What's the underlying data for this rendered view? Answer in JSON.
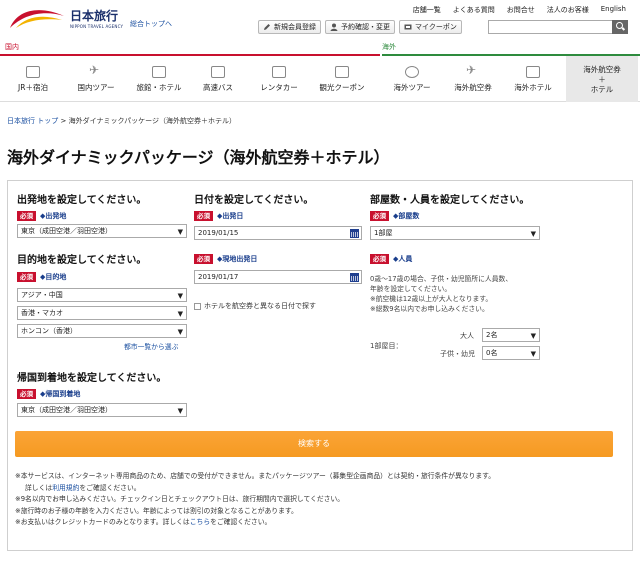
{
  "header": {
    "brand": "日本旅行",
    "brand_en": "NIPPON TRAVEL AGENCY",
    "general_top": "総合トップへ",
    "util_links": [
      "店舗一覧",
      "よくある質問",
      "お問合せ",
      "法人のお客様",
      "English"
    ],
    "member_buttons": [
      "新規会員登録",
      "予約確認・変更",
      "マイクーポン"
    ],
    "search_value": ""
  },
  "nav": {
    "domestic_label": "国内",
    "intl_label": "海外",
    "items": [
      "JR＋宿泊",
      "国内ツアー",
      "旅館・ホテル",
      "高速バス",
      "レンタカー",
      "観光クーポン",
      "海外ツアー",
      "海外航空券",
      "海外ホテル",
      "海外航空券＋ホテル"
    ],
    "active_lines": [
      "海外航空券",
      "＋",
      "ホテル"
    ]
  },
  "breadcrumb": {
    "home": "日本旅行 トップ",
    "sep": ">",
    "current": "海外ダイナミックパッケージ（海外航空券＋ホテル）"
  },
  "page_title": "海外ダイナミックパッケージ（海外航空券＋ホテル）",
  "form": {
    "required": "必須",
    "departure": {
      "heading": "出発地を設定してください。",
      "field": "◆出発地",
      "value": "東京（成田空港／羽田空港）"
    },
    "destination": {
      "heading": "目的地を設定してください。",
      "field": "◆目的地",
      "region": "アジア・中国",
      "country": "香港・マカオ",
      "city": "ホンコン（香港）",
      "city_list_link": "都市一覧から選ぶ"
    },
    "return": {
      "heading": "帰国到着地を設定してください。",
      "field": "◆帰国到着地",
      "value": "東京（成田空港／羽田空港）"
    },
    "dates": {
      "heading": "日付を設定してください。",
      "depart_field": "◆出発日",
      "depart_value": "2019/01/15",
      "local_field": "◆現地出発日",
      "local_value": "2019/01/17",
      "diff_date_checkbox": "ホテルを航空券と異なる日付で探す"
    },
    "rooms": {
      "heading": "部屋数・人員を設定してください。",
      "rooms_field": "◆部屋数",
      "rooms_value": "1部屋",
      "people_field": "◆人員",
      "notes": [
        "0歳～17歳の場合、子供・幼児箇所に人員数、",
        "年齢を設定してください。",
        "※航空機は12歳以上が大人となります。",
        "※総数9名以内でお申し込みください。"
      ],
      "room_label": "1部屋目：",
      "adult_label": "大人",
      "adult_value": "2名",
      "child_label": "子供・幼児",
      "child_value": "0名"
    },
    "submit": "検索する"
  },
  "notes": {
    "line1": "※本サービスは、インターネット専用商品のため、店舗での受付ができません。またパッケージツアー（募集型企画商品）とは契約・旅行条件が異なります。",
    "line2_prefix": "詳しくは",
    "line2_link": "利用規約",
    "line2_suffix": "をご確認ください。",
    "line3": "※9名以内でお申し込みください。チェックイン日とチェックアウト日は、旅行期間内で選択してください。",
    "line4": "※旅行時のお子様の年齢を入力ください。年齢によっては割引の対象となることがあります。",
    "line5_prefix": "※お支払いはクレジットカードのみとなります。詳しくは",
    "line5_link": "こちら",
    "line5_suffix": "をご確認ください。"
  },
  "colors": {
    "brand_red": "#c8102e",
    "intl_green": "#2e8b3e",
    "submit_orange": "#f59a21",
    "link_blue": "#1a4fa0"
  }
}
